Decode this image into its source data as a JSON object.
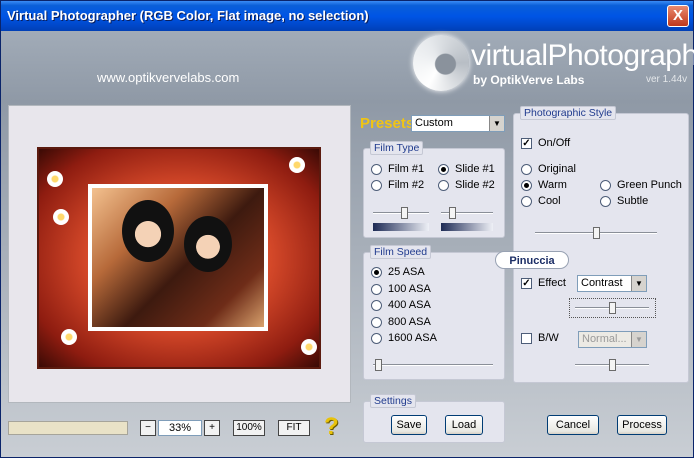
{
  "window": {
    "title": "Virtual Photographer (RGB Color, Flat image, no selection)",
    "close": "X"
  },
  "header": {
    "website": "www.optikvervelabs.com",
    "logo_text": "virtualPhotographer",
    "logo_by": "by OptikVerve Labs",
    "version": "ver 1.44v"
  },
  "preview": {
    "zoom_minus": "−",
    "zoom_value": "33%",
    "zoom_plus": "+",
    "zoom_100": "100%",
    "zoom_fit": "FIT",
    "help": "?"
  },
  "presets": {
    "label": "Presets",
    "selected": "Custom"
  },
  "film_type": {
    "title": "Film Type",
    "options": [
      "Film #1",
      "Slide #1",
      "Film #2",
      "Slide #2"
    ],
    "selected": "Slide #1",
    "slider1_level": 0.55,
    "slider2_level": 0.2
  },
  "film_speed": {
    "title": "Film Speed",
    "options": [
      "25 ASA",
      "100 ASA",
      "400 ASA",
      "800 ASA",
      "1600 ASA"
    ],
    "selected": "25 ASA",
    "slider_level": 0.0
  },
  "photographic_style": {
    "title": "Photographic Style",
    "onoff_label": "On/Off",
    "onoff_checked": true,
    "options": [
      "Original",
      "Warm",
      "Green Punch",
      "Cool",
      "Subtle"
    ],
    "selected": "Warm",
    "style_slider_level": 0.5
  },
  "effect": {
    "watermark": "Pinuccia",
    "label": "Effect",
    "checked": true,
    "selected": "Contrast",
    "slider_level": 0.5
  },
  "bw": {
    "label": "B/W",
    "checked": false,
    "selected": "Normal...",
    "slider_level": 0.5
  },
  "settings": {
    "title": "Settings",
    "save": "Save",
    "load": "Load"
  },
  "actions": {
    "cancel": "Cancel",
    "process": "Process"
  },
  "colors": {
    "titlebar": "#0055e5",
    "accent_presets": "#f0c414",
    "group_title": "#203b8e"
  }
}
